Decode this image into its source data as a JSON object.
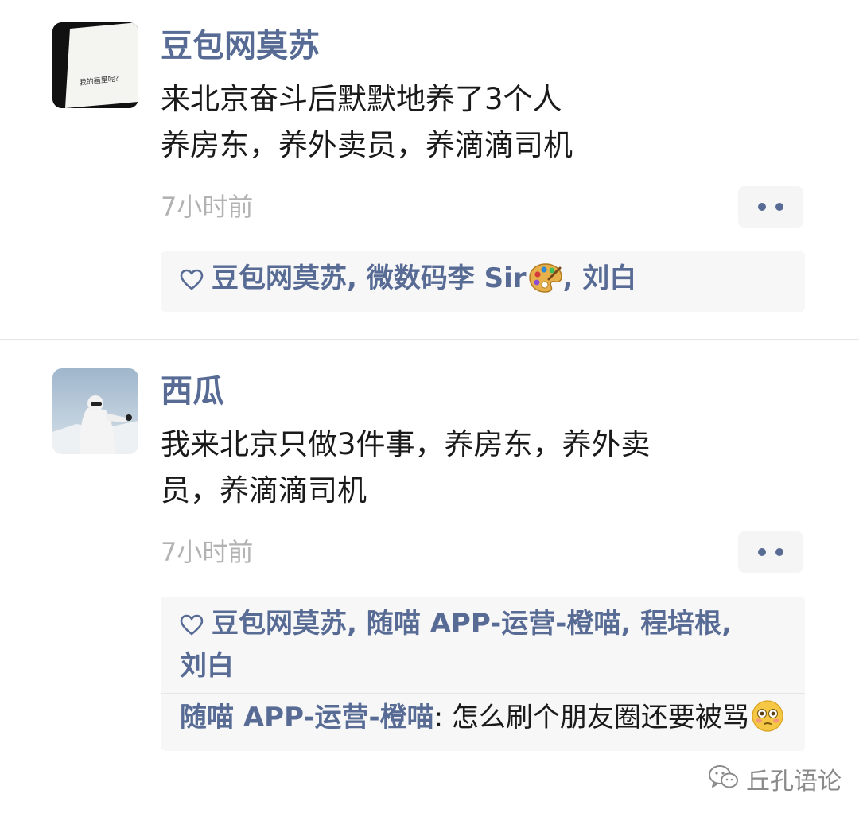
{
  "posts": [
    {
      "author": "豆包网莫苏",
      "avatar_text": "我的画里呢？",
      "content_lines": [
        "来北京奋斗后默默地养了3个人",
        "养房东，养外卖员，养滴滴司机"
      ],
      "time": "7小时前",
      "likes": [
        "豆包网莫苏",
        "微数码李 Sir",
        "刘白"
      ],
      "comments": []
    },
    {
      "author": "西瓜",
      "content_lines": [
        "我来北京只做3件事，养房东，养外卖",
        "员，养滴滴司机"
      ],
      "time": "7小时前",
      "likes": [
        "豆包网莫苏",
        "随喵 APP-运营-橙喵",
        "程培根",
        "刘白"
      ],
      "comments": [
        {
          "author": "随喵 APP-运营-橙喵",
          "text": "怎么刷个朋友圈还要被骂"
        }
      ]
    }
  ],
  "separator": ",",
  "colon": ":",
  "watermark": "丘孔语论",
  "icons": {
    "more": "more-dots-icon",
    "like": "heart-outline-icon",
    "palette": "artist-palette-emoji",
    "face": "flushed-face-emoji",
    "wechat": "wechat-logo-icon"
  },
  "colors": {
    "name_link": "#576b95",
    "time": "#b2b2b2",
    "likes_bg": "#f7f7f7"
  }
}
